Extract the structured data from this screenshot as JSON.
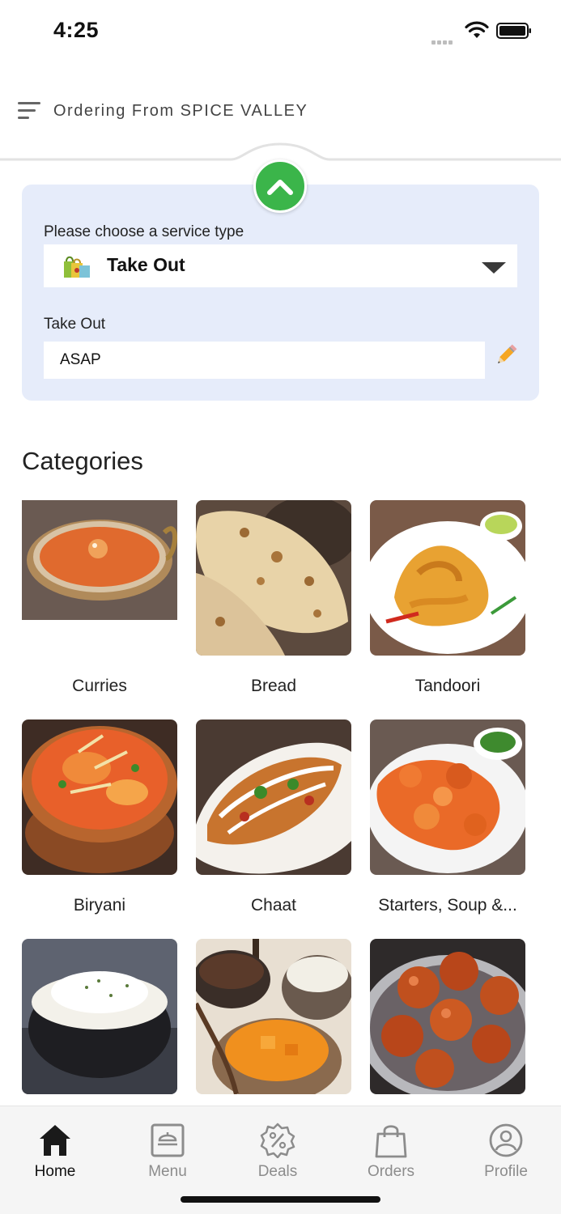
{
  "status_bar": {
    "time": "4:25"
  },
  "header": {
    "title": "Ordering From SPICE VALLEY"
  },
  "service": {
    "label": "Please choose a service type",
    "selected": "Take Out",
    "time_label": "Take Out",
    "time_value": "ASAP"
  },
  "categories": {
    "title": "Categories",
    "items": [
      {
        "name": "Curries"
      },
      {
        "name": "Bread"
      },
      {
        "name": "Tandoori"
      },
      {
        "name": "Biryani"
      },
      {
        "name": "Chaat"
      },
      {
        "name": "Starters, Soup &..."
      },
      {
        "name": ""
      },
      {
        "name": ""
      },
      {
        "name": ""
      }
    ]
  },
  "tabbar": {
    "tabs": [
      {
        "label": "Home"
      },
      {
        "label": "Menu"
      },
      {
        "label": "Deals"
      },
      {
        "label": "Orders"
      },
      {
        "label": "Profile"
      }
    ]
  },
  "colors": {
    "accent_green": "#3bb54a",
    "panel_bg": "#e6ecfa",
    "tab_active": "#111111",
    "tab_inactive": "#8c8c8c"
  }
}
